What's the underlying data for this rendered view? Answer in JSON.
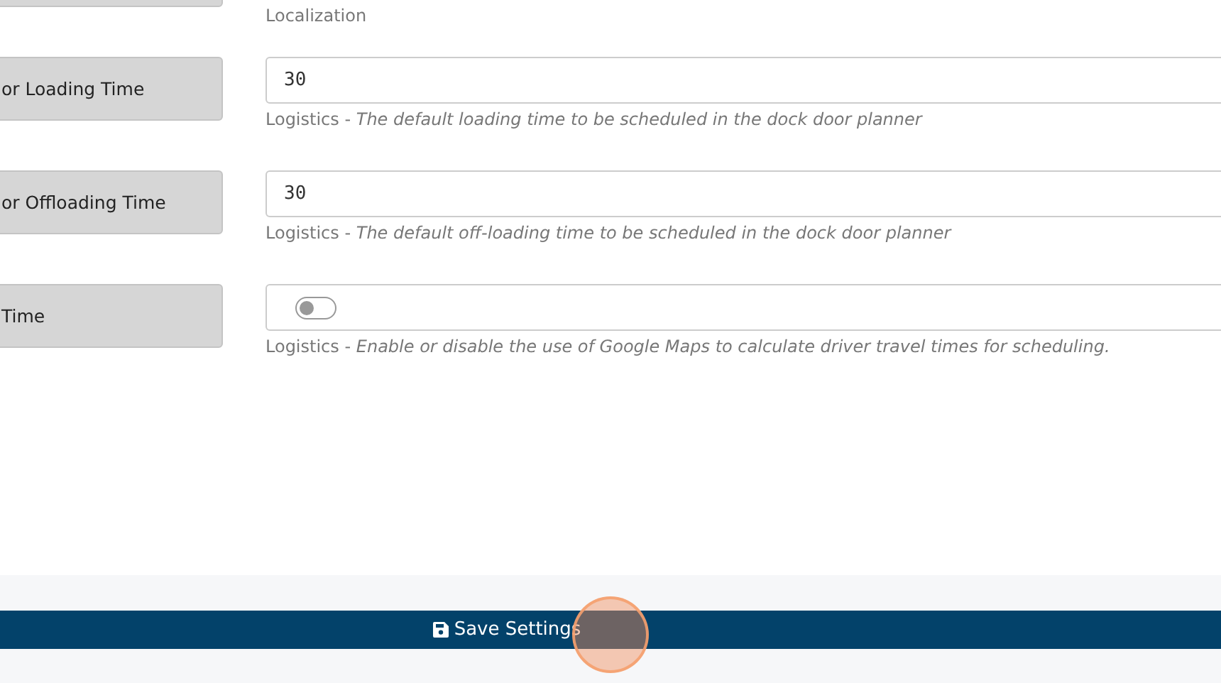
{
  "top_hint": "Localization",
  "settings": [
    {
      "kind": "number",
      "label": "or Loading Time",
      "value": "30",
      "hint": "Logistics - *The default loading time to be scheduled in the dock door planner*"
    },
    {
      "kind": "number",
      "label": "or Offloading Time",
      "value": "30",
      "hint": "Logistics - *The default off-loading time to be scheduled in the dock door planner*"
    },
    {
      "kind": "toggle",
      "label": "Time",
      "on": false,
      "hint": "Logistics - *Enable or disable the use of Google Maps to calculate driver travel times for scheduling.*"
    }
  ],
  "save_button": "Save Settings"
}
